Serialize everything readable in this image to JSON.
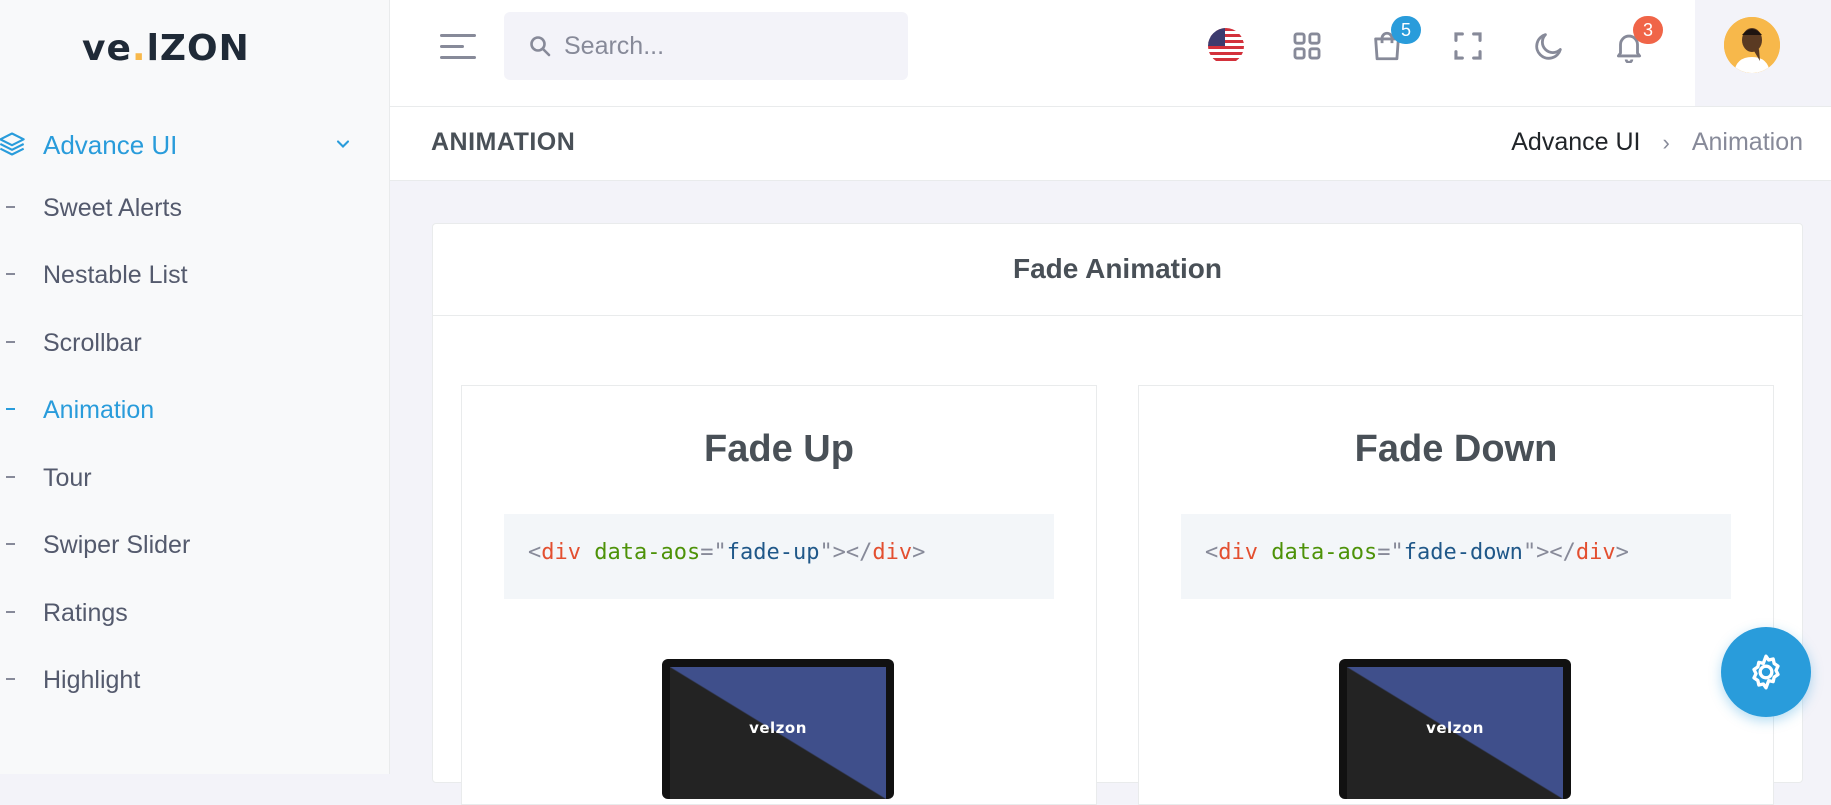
{
  "brand": {
    "logo_text_prefix": "ve",
    "logo_dot": ".",
    "logo_text_suffix": "lZON",
    "logo_mini": "velzon"
  },
  "sidebar": {
    "parent": {
      "label": "Advance UI",
      "icon": "layers-icon"
    },
    "items": [
      {
        "label": "Sweet Alerts",
        "active": false
      },
      {
        "label": "Nestable List",
        "active": false
      },
      {
        "label": "Scrollbar",
        "active": false
      },
      {
        "label": "Animation",
        "active": true
      },
      {
        "label": "Tour",
        "active": false
      },
      {
        "label": "Swiper Slider",
        "active": false
      },
      {
        "label": "Ratings",
        "active": false
      },
      {
        "label": "Highlight",
        "active": false
      }
    ]
  },
  "topbar": {
    "search_placeholder": "Search...",
    "cart_badge": "5",
    "notifications_badge": "3",
    "colors": {
      "cart_badge": "#299cdb",
      "notifications_badge": "#f06548"
    }
  },
  "page": {
    "title": "ANIMATION",
    "breadcrumb": {
      "parent": "Advance UI",
      "separator": "›",
      "current": "Animation"
    }
  },
  "card": {
    "title": "Fade Animation",
    "demos": [
      {
        "heading": "Fade Up",
        "code": {
          "open": "<",
          "tag": "div",
          "attr": "data-aos",
          "eq": "=\"",
          "value": "fade-up",
          "close_quote": "\"></",
          "close_tag": "div",
          "end": ">"
        }
      },
      {
        "heading": "Fade Down",
        "code": {
          "open": "<",
          "tag": "div",
          "attr": "data-aos",
          "eq": "=\"",
          "value": "fade-down",
          "close_quote": "\"></",
          "close_tag": "div",
          "end": ">"
        }
      }
    ]
  },
  "colors": {
    "accent": "#299cdb",
    "sidebar_bg": "#f8f9fa",
    "page_bg": "#f3f3f9"
  }
}
